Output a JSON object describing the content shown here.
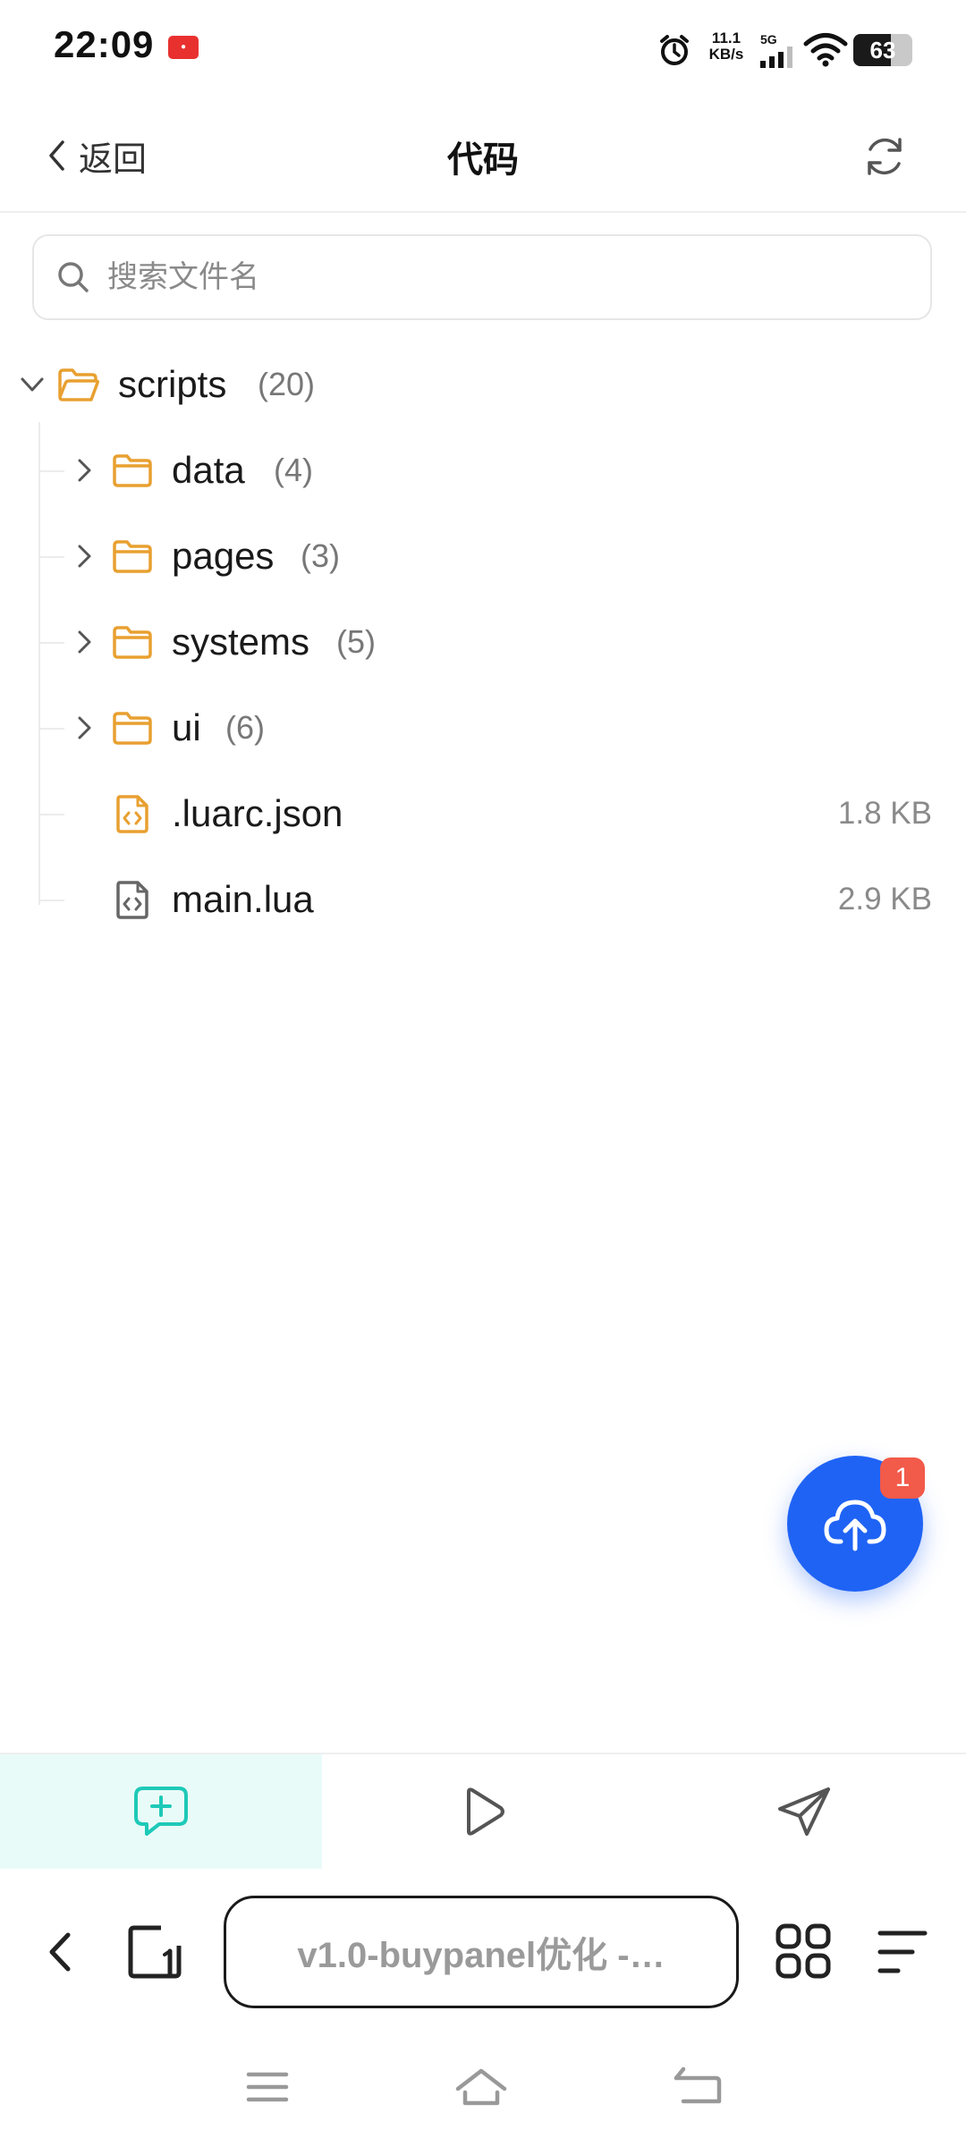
{
  "status_bar": {
    "time": "22:09",
    "net_speed_value": "11.1",
    "net_speed_unit": "KB/s",
    "signal_label": "5G",
    "battery_percent": 63,
    "battery_text": "63"
  },
  "header": {
    "back_label": "返回",
    "title": "代码"
  },
  "search": {
    "placeholder": "搜索文件名",
    "value": ""
  },
  "tree": {
    "root": {
      "name": "scripts",
      "count": "(20)",
      "expanded": true
    },
    "items": [
      {
        "type": "folder",
        "name": "data",
        "count": "(4)"
      },
      {
        "type": "folder",
        "name": "pages",
        "count": "(3)"
      },
      {
        "type": "folder",
        "name": "systems",
        "count": "(5)"
      },
      {
        "type": "folder",
        "name": "ui",
        "count": "(6)"
      },
      {
        "type": "file",
        "name": ".luarc.json",
        "size": "1.8 KB"
      },
      {
        "type": "file",
        "name": "main.lua",
        "size": "2.9 KB"
      }
    ]
  },
  "fab": {
    "badge": "1"
  },
  "browser": {
    "url_text": "v1.0-buypanel优化 -…"
  },
  "colors": {
    "accent": "#1f63f5",
    "folder": "#e8a030",
    "badge": "#f25a4a",
    "chat_tab_bg": "#e9fbf8",
    "chat_icon": "#1ec9b8"
  }
}
